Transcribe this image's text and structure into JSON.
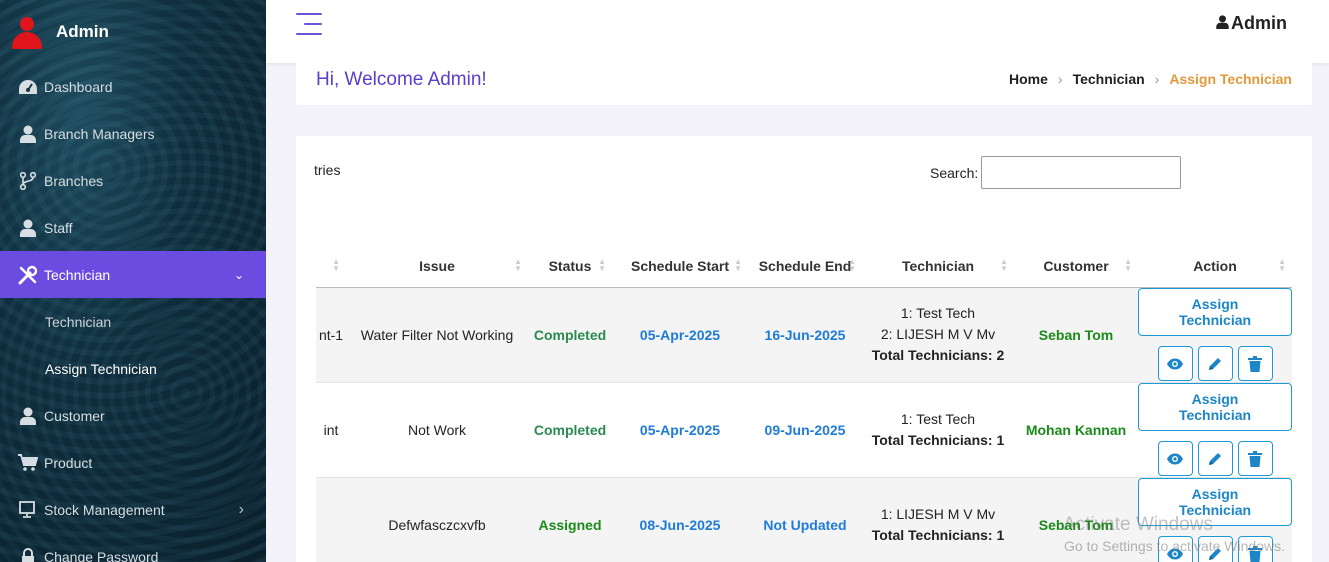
{
  "sidebar": {
    "brand": "Admin",
    "items": [
      {
        "label": "Dashboard"
      },
      {
        "label": "Branch Managers"
      },
      {
        "label": "Branches"
      },
      {
        "label": "Staff"
      },
      {
        "label": "Technician"
      },
      {
        "label": "Customer"
      },
      {
        "label": "Product"
      },
      {
        "label": "Stock Management"
      },
      {
        "label": "Change Password"
      }
    ],
    "sub_items": [
      {
        "label": "Technician"
      },
      {
        "label": "Assign Technician"
      }
    ],
    "active_color": "#6a4de0"
  },
  "header": {
    "user": "Admin"
  },
  "welcome": {
    "title": "Hi, Welcome Admin!",
    "breadcrumb": [
      "Home",
      "Technician",
      "Assign Technician"
    ]
  },
  "table_controls": {
    "entries_text": "tries",
    "search_label": "Search:",
    "search_value": ""
  },
  "table": {
    "headers": [
      "",
      "Issue",
      "Status",
      "Schedule Start",
      "Schedule End",
      "Technician",
      "Customer",
      "Action"
    ],
    "rows": [
      {
        "col0": "nt-1",
        "issue": "Water Filter Not Working",
        "status": "Completed",
        "start": "05-Apr-2025",
        "end": "16-Jun-2025",
        "tech1": "1: Test Tech",
        "tech2": "2: LIJESH M V Mv",
        "total": "Total Technicians: 2",
        "customer": "Seban Tom",
        "assign": "Assign Technician"
      },
      {
        "col0": "int",
        "issue": "Not Work",
        "status": "Completed",
        "start": "05-Apr-2025",
        "end": "09-Jun-2025",
        "tech1": "1: Test Tech",
        "total": "Total Technicians: 1",
        "customer": "Mohan Kannan",
        "assign": "Assign Technician"
      },
      {
        "col0": "",
        "issue": "Defwfasczcxvfb",
        "status": "Assigned",
        "start": "08-Jun-2025",
        "end": "Not Updated",
        "tech1": "1: LIJESH M V Mv",
        "total": "Total Technicians: 1",
        "customer": "Seban Tom",
        "assign": "Assign Technician"
      }
    ]
  },
  "watermark": {
    "line1": "Activate Windows",
    "line2": "Go to Settings to activate Windows."
  }
}
